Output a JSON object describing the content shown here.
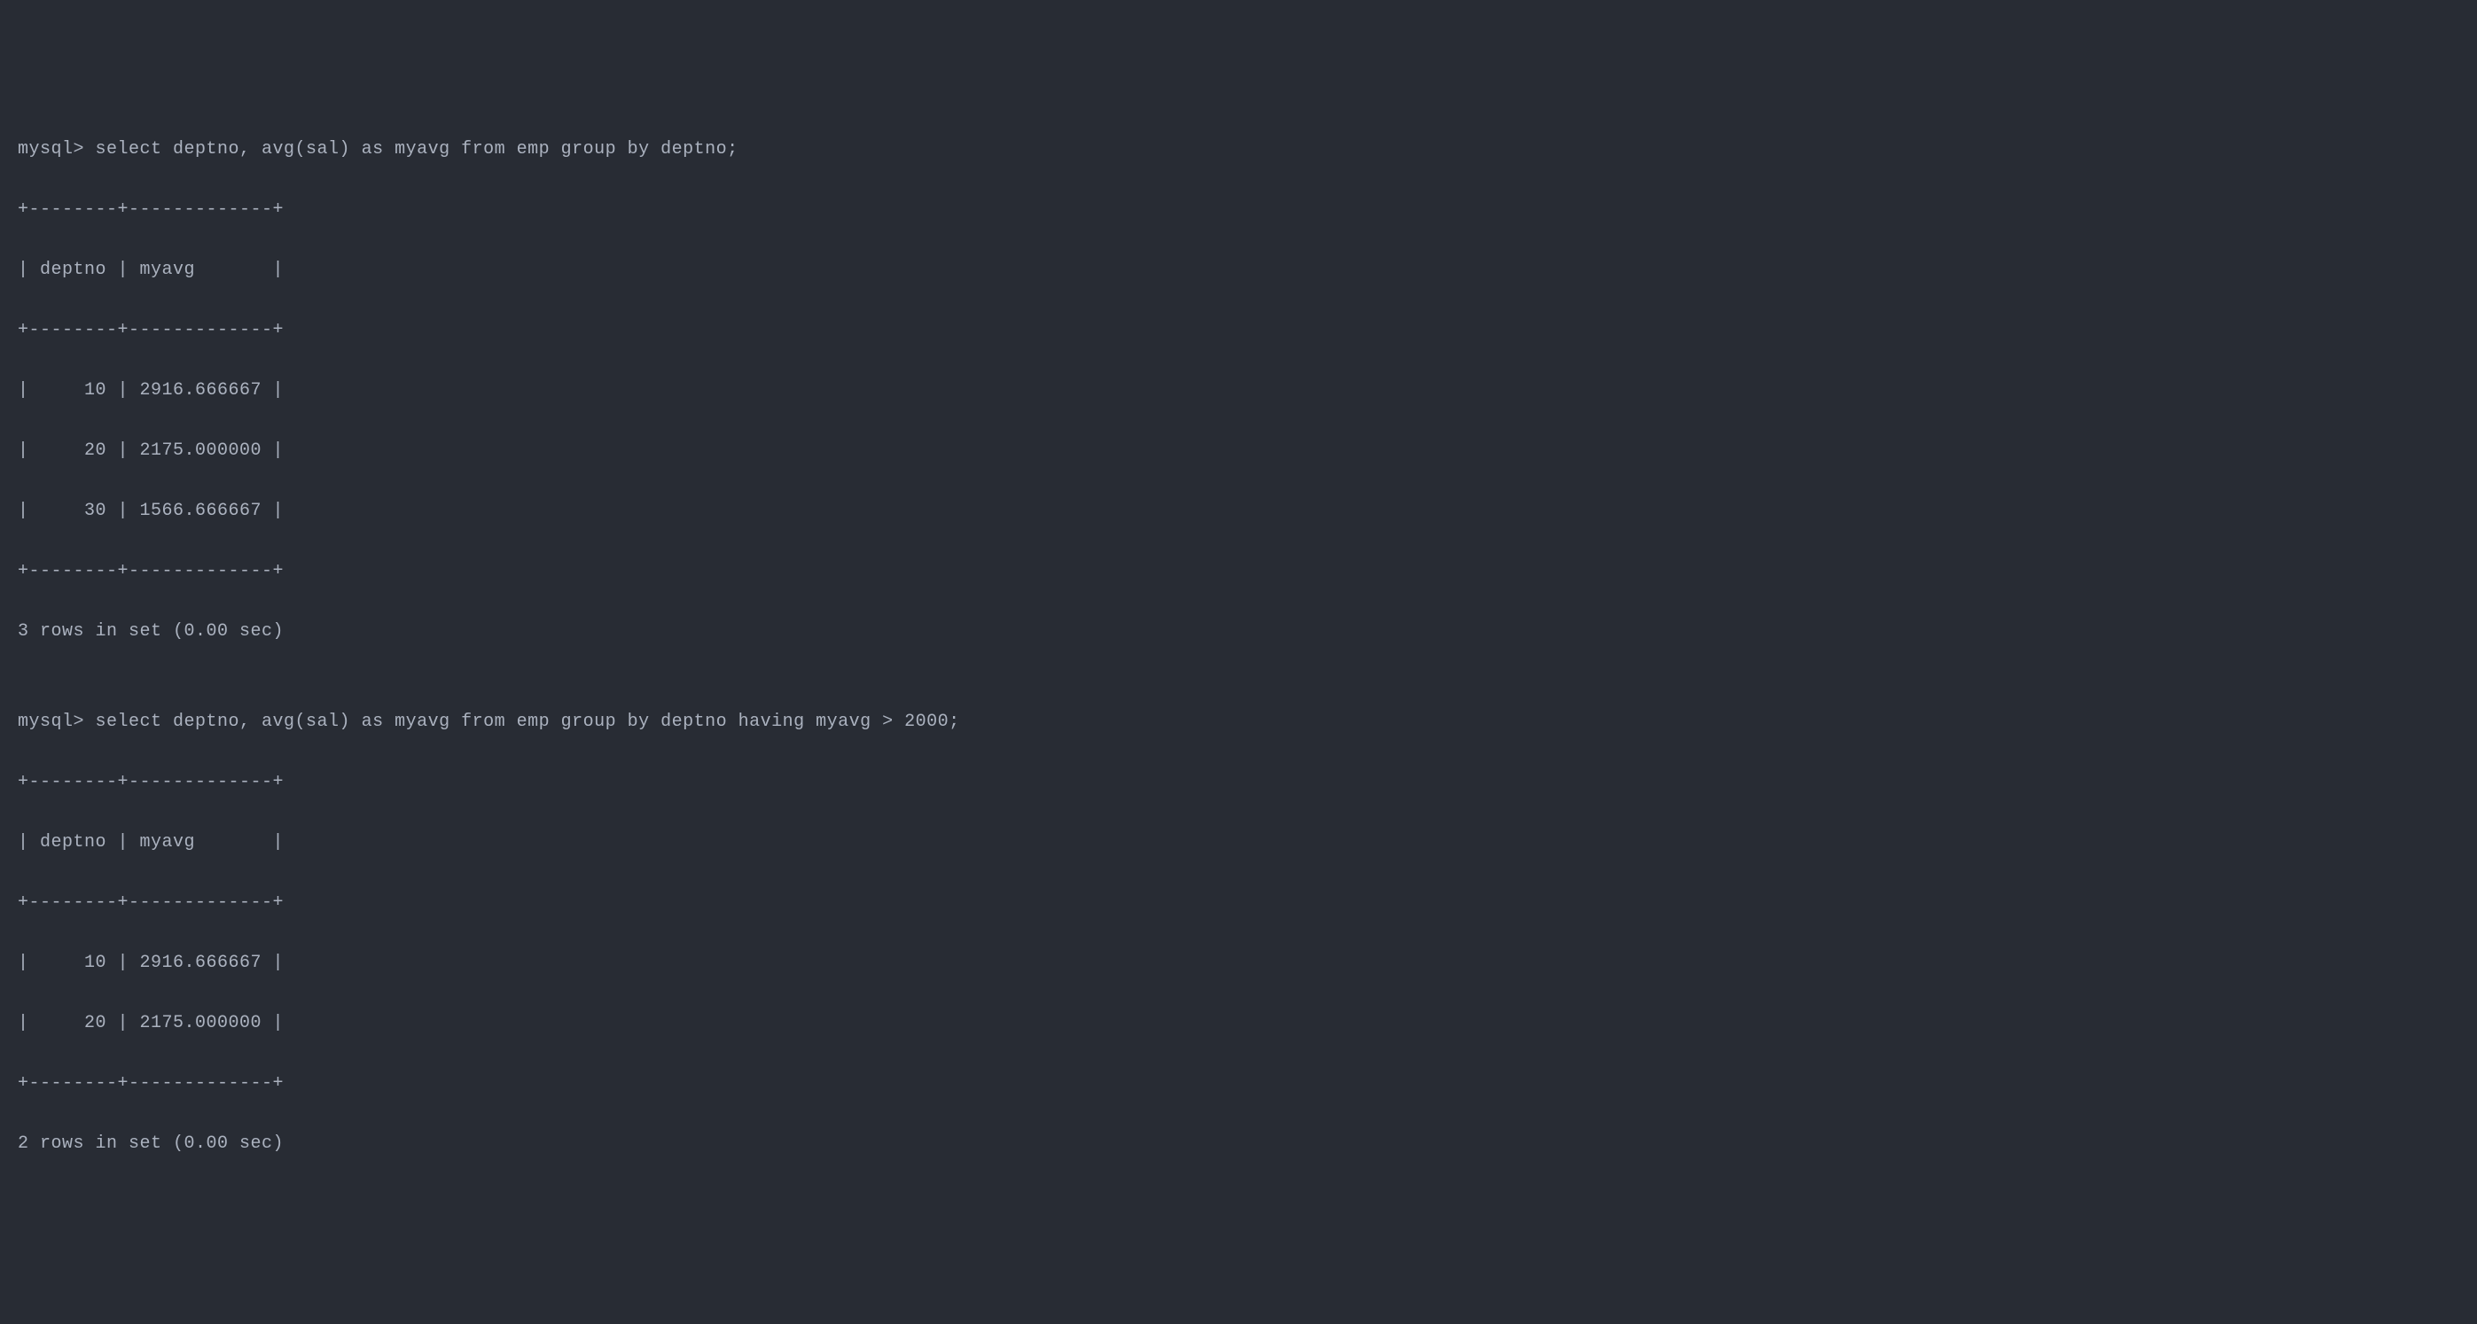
{
  "query1": {
    "prompt": "mysql> ",
    "sql": "select deptno, avg(sal) as myavg from emp group by deptno;",
    "border": "+--------+-------------+",
    "header": "| deptno | myavg       |",
    "rows": [
      "|     10 | 2916.666667 |",
      "|     20 | 2175.000000 |",
      "|     30 | 1566.666667 |"
    ],
    "footer": "3 rows in set (0.00 sec)"
  },
  "blank": "",
  "query2": {
    "prompt": "mysql> ",
    "sql": "select deptno, avg(sal) as myavg from emp group by deptno having myavg > 2000;",
    "border": "+--------+-------------+",
    "header": "| deptno | myavg       |",
    "rows": [
      "|     10 | 2916.666667 |",
      "|     20 | 2175.000000 |"
    ],
    "footer": "2 rows in set (0.00 sec)"
  }
}
